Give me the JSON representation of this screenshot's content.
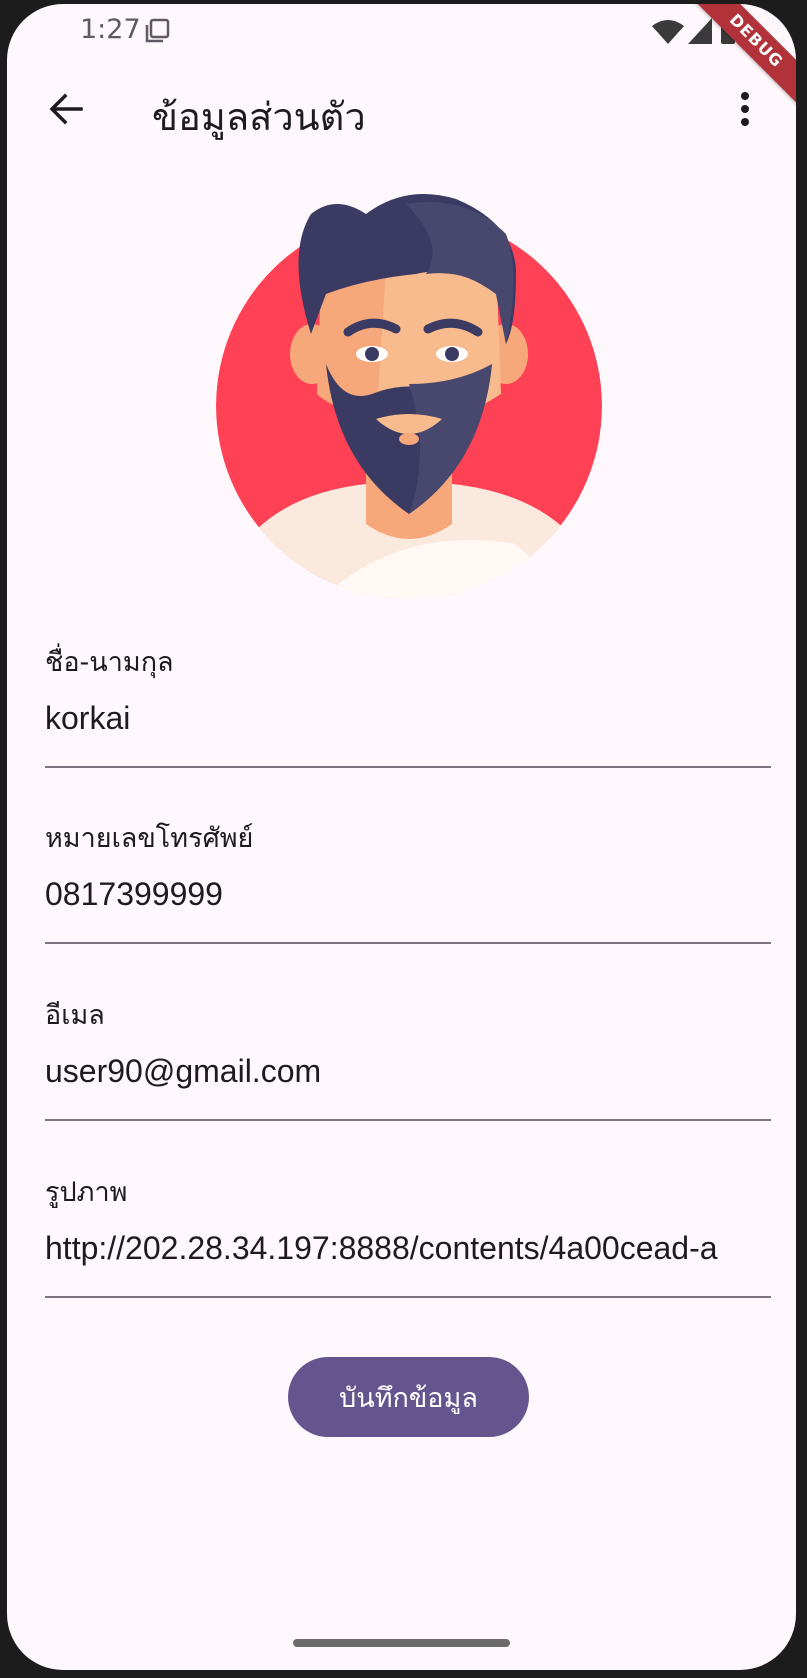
{
  "status_bar": {
    "time": "1:27",
    "icons": [
      "screenshot-icon",
      "wifi-icon",
      "signal-icon",
      "battery-icon"
    ]
  },
  "debug_banner": "DEBUG",
  "app_bar": {
    "title": "ข้อมูลส่วนตัว",
    "back_icon": "arrow-back-icon",
    "menu_icon": "more-vert-icon"
  },
  "avatar": {
    "description_icon": "bearded-man-avatar",
    "bg_color": "#ff4155"
  },
  "form": {
    "fields": [
      {
        "label": "ชื่อ-นามกุล",
        "value": "korkai"
      },
      {
        "label": "หมายเลขโทรศัพย์",
        "value": "0817399999"
      },
      {
        "label": "อีเมล",
        "value": "user90@gmail.com"
      },
      {
        "label": "รูปภาพ",
        "value": "http://202.28.34.197:8888/contents/4a00cead-a"
      }
    ],
    "save_label": "บันทึกข้อมูล"
  },
  "colors": {
    "background": "#fef7fc",
    "primary": "#65558f",
    "text": "#1d1b20",
    "underline": "#79747e"
  }
}
